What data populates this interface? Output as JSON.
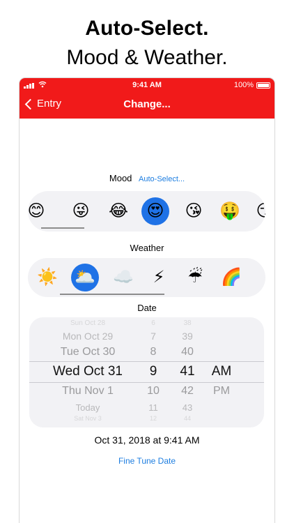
{
  "promo": {
    "title": "Auto-Select.",
    "subtitle": "Mood & Weather."
  },
  "status_bar": {
    "time": "9:41 AM",
    "battery": "100%"
  },
  "navbar": {
    "back_label": "Entry",
    "title": "Change..."
  },
  "mood": {
    "label": "Mood",
    "auto_select": "Auto-Select...",
    "selected_index": 3,
    "emojis": [
      "😊",
      "😜",
      "😂",
      "😍",
      "😘",
      "🤑",
      "😏"
    ]
  },
  "weather": {
    "label": "Weather",
    "selected_index": 1,
    "icons": [
      "☀️",
      "🌥️",
      "☁️",
      "⚡",
      "☔",
      "🌈"
    ]
  },
  "date": {
    "label": "Date",
    "picker": {
      "rows": [
        {
          "date": "Sun Oct 28",
          "hour": "6",
          "minute": "38",
          "ampm": ""
        },
        {
          "date": "Mon Oct 29",
          "hour": "7",
          "minute": "39",
          "ampm": ""
        },
        {
          "date": "Tue Oct 30",
          "hour": "8",
          "minute": "40",
          "ampm": ""
        },
        {
          "date": "Wed Oct 31",
          "hour": "9",
          "minute": "41",
          "ampm": "AM"
        },
        {
          "date": "Thu Nov 1",
          "hour": "10",
          "minute": "42",
          "ampm": "PM"
        },
        {
          "date": "Today",
          "hour": "11",
          "minute": "43",
          "ampm": ""
        },
        {
          "date": "Sat Nov 3",
          "hour": "12",
          "minute": "44",
          "ampm": ""
        }
      ]
    },
    "summary": "Oct 31, 2018 at 9:41 AM",
    "fine_tune": "Fine Tune Date"
  }
}
